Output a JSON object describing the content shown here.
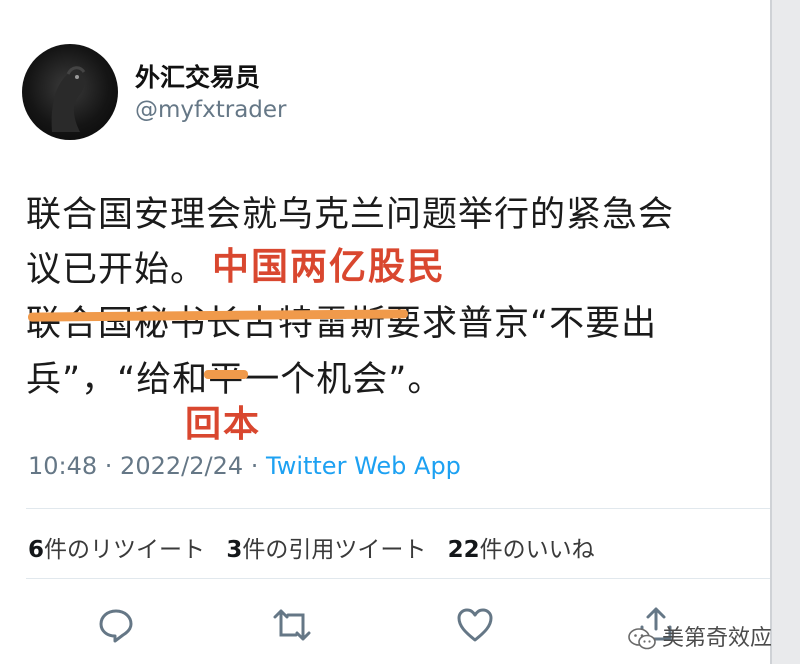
{
  "tweet": {
    "display_name": "外汇交易员",
    "handle": "@myfxtrader",
    "lines": [
      "联合国安理会就乌克兰问题举行的紧急会",
      "议已开始。",
      "联合国秘书长古特雷斯要求普京“不要出",
      "兵”，“给和平一个机会”。"
    ],
    "time": "10:48 · 2022/2/24 · ",
    "app": "Twitter Web App"
  },
  "overlays": {
    "line1": "中国两亿股民",
    "line2": "回本"
  },
  "stats": {
    "retweets_count": "6",
    "retweets_label": "件のリツイート",
    "quotes_count": "3",
    "quotes_label": "件の引用ツイート",
    "likes_count": "22",
    "likes_label": "件のいいね"
  },
  "watermark": {
    "text": "美第奇效应"
  },
  "icons": [
    "avatar",
    "reply-icon",
    "retweet-icon",
    "like-icon",
    "share-icon",
    "wechat-icon"
  ],
  "colors": {
    "link": "#1da1f2",
    "overlay_red": "#d9472f",
    "strike_orange": "#f09a4b",
    "muted": "#657786"
  }
}
